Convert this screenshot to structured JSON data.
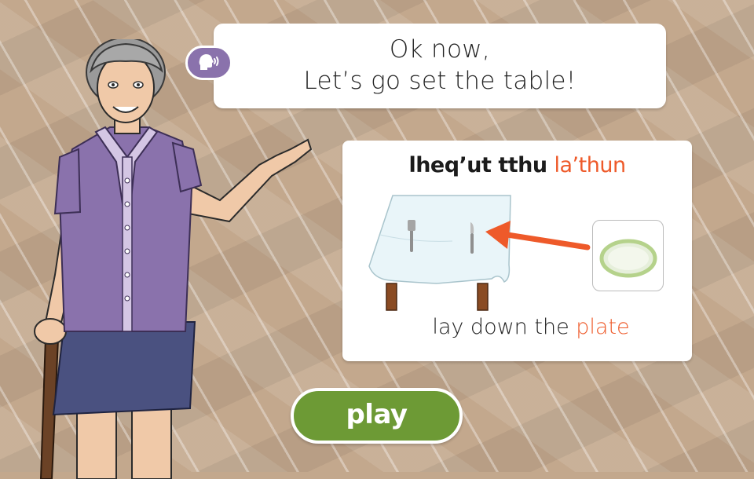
{
  "speech": {
    "line1": "Ok now,",
    "line2": "Let’s go set the table!"
  },
  "audio_button": {
    "icon": "speaking-head-icon"
  },
  "card": {
    "title_prefix": "lheq’ut tthu ",
    "title_highlight": "la’thun",
    "subtitle_prefix": "lay down the ",
    "subtitle_highlight": "plate",
    "highlight_color": "#ee5a2a"
  },
  "play_button": {
    "label": "play",
    "color": "#6d9a35"
  },
  "colors": {
    "accent_purple": "#8a72ac"
  }
}
